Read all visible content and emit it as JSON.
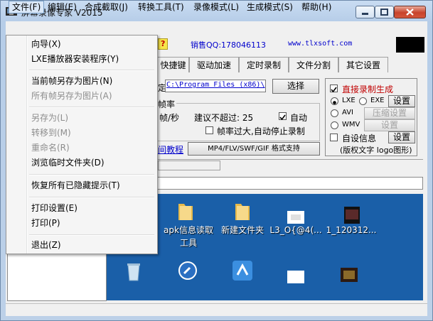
{
  "window": {
    "title": "屏幕录像专家 V2015"
  },
  "menubar": [
    "文件(F)",
    "编辑(E)",
    "合成截取(J)",
    "转换工具(T)",
    "录像模式(L)",
    "生成模式(S)",
    "帮助(H)"
  ],
  "toolbar": {
    "help_icon": "?",
    "qq": "销售QQ:178046113",
    "website": "www.tlxsoft.com"
  },
  "tabs": [
    "快捷键",
    "驱动加速",
    "定时录制",
    "文件分割",
    "其它设置"
  ],
  "settings": {
    "path_prefix": "定:",
    "path_value": "C:\\Program Files (x86)\\",
    "browse_button": "选择",
    "framerate_legend": "帧率",
    "fps_unit": "帧/秒",
    "max_hint": "建议不超过: 25",
    "auto_label": "自动",
    "stop_on_high": "帧率过大,自动停止录制",
    "tutorial_link": "间教程",
    "format_button": "MP4/FLV/SWF/GIF  格式支持"
  },
  "output_panel": {
    "direct_gen": "直接录制生成",
    "lxe": "LXE",
    "exe": "EXE",
    "avi": "AVI",
    "wmv": "WMV",
    "setting1": "设置",
    "compress": "压缩设置",
    "setting2": "设置",
    "custom_info": "自设信息",
    "setting3": "设置",
    "copyright": "(版权文字 logo图形)"
  },
  "desktop": {
    "row1": [
      "",
      "apk信息读取工具",
      "新建文件夹",
      "L3_O{@4(...",
      "1_120312..."
    ]
  },
  "file_menu": {
    "items": [
      {
        "label": "向导(X)",
        "disabled": false
      },
      {
        "label": "LXE播放器安装程序(Y)",
        "disabled": false
      },
      {
        "sep": true
      },
      {
        "label": "当前帧另存为图片(N)",
        "disabled": false
      },
      {
        "label": "所有帧另存为图片(A)",
        "disabled": true
      },
      {
        "sep": true
      },
      {
        "label": "另存为(L)",
        "disabled": true
      },
      {
        "label": "转移到(M)",
        "disabled": true
      },
      {
        "label": "重命名(R)",
        "disabled": true
      },
      {
        "label": "浏览临时文件夹(D)",
        "disabled": false
      },
      {
        "sep": true
      },
      {
        "label": "恢复所有已隐藏提示(T)",
        "disabled": false
      },
      {
        "sep": true
      },
      {
        "label": "打印设置(E)",
        "disabled": false
      },
      {
        "label": "打印(P)",
        "disabled": false
      },
      {
        "sep": true
      },
      {
        "label": "退出(Z)",
        "disabled": false
      }
    ]
  },
  "colors": {
    "accent_red": "#c00000",
    "link_blue": "#0000cc",
    "desktop_blue": "#1a5fa8"
  }
}
